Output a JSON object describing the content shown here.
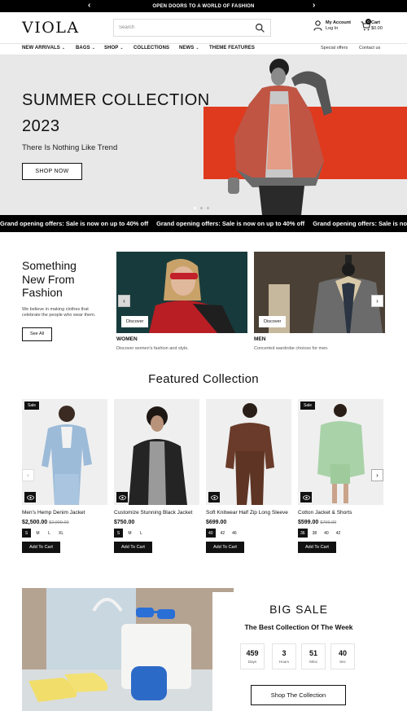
{
  "announcement": {
    "text": "OPEN DOORS TO A WORLD OF FASHION"
  },
  "header": {
    "logo": "VIOLA",
    "search_placeholder": "Search",
    "account_title": "My Account",
    "account_sub": "Log In",
    "cart_title": "Cart",
    "cart_total": "$0.00",
    "cart_count": "0"
  },
  "nav": {
    "items": [
      "NEW ARRIVALS",
      "BAGS",
      "SHOP",
      "COLLECTIONS",
      "NEWS",
      "THEME FEATURES"
    ],
    "secondary": [
      "Special offers",
      "Contact us"
    ]
  },
  "hero": {
    "title_line1": "SUMMER COLLECTION",
    "title_line2": "2023",
    "tagline": "There Is Nothing Like Trend",
    "button": "SHOP NOW",
    "accent_color": "#e03a1e"
  },
  "ticker": {
    "text": "Grand opening offers: Sale is now on up to 40% off"
  },
  "categories": {
    "heading_line1": "Something",
    "heading_line2": "New From",
    "heading_line3": "Fashion",
    "description": "We believe in making clothes that celebrate the people who wear them.",
    "see_all": "See All",
    "cards": [
      {
        "label": "WOMEN",
        "desc": "Discover women's fashion and style.",
        "button": "Discover"
      },
      {
        "label": "MEN",
        "desc": "Concerted wardrobe choices for men.",
        "button": "Discover"
      }
    ]
  },
  "featured": {
    "title": "Featured Collection",
    "sale_badge": "Sale",
    "add_to_cart": "Add To Cart",
    "products": [
      {
        "name": "Men's Hemp Denim Jacket",
        "price": "$2,500.00",
        "compare": "$2,999.00",
        "sizes": [
          "S",
          "M",
          "L",
          "XL"
        ]
      },
      {
        "name": "Customize Stunning Black Jacket",
        "price": "$750.00",
        "compare": "",
        "sizes": [
          "S",
          "M",
          "L"
        ]
      },
      {
        "name": "Soft Knitwear Half Zip Long Sleeve",
        "price": "$699.00",
        "compare": "",
        "sizes": [
          "40",
          "42",
          "46"
        ]
      },
      {
        "name": "Cotton Jacket & Shorts",
        "price": "$599.00",
        "compare": "$799.00",
        "sizes": [
          "36",
          "38",
          "40",
          "42"
        ]
      }
    ]
  },
  "sale": {
    "title": "BIG SALE",
    "subtitle": "The Best Collection Of The Week",
    "countdown": [
      {
        "value": "459",
        "unit": "Days"
      },
      {
        "value": "3",
        "unit": "Hours"
      },
      {
        "value": "51",
        "unit": "Mins"
      },
      {
        "value": "40",
        "unit": "Sec"
      }
    ],
    "button": "Shop The Collection"
  }
}
